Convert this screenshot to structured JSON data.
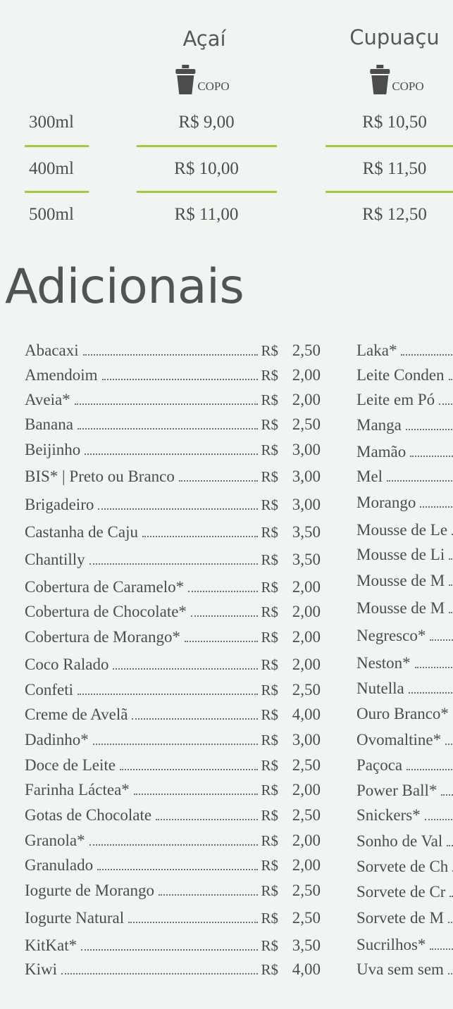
{
  "precos": {
    "colunas": [
      {
        "titulo": "Açaí",
        "copo": "COPO",
        "valores": [
          "R$ 9,00",
          "R$ 10,00",
          "R$ 11,00"
        ]
      },
      {
        "titulo": "Cupuaçu",
        "copo": "COPO",
        "valores": [
          "R$ 10,50",
          "R$ 11,50",
          "R$ 12,50"
        ]
      }
    ],
    "tamanhos": [
      "300ml",
      "400ml",
      "500ml"
    ],
    "accent": "#a6c93a"
  },
  "adicionais": {
    "titulo": "Adicionais",
    "moeda": "R$",
    "esquerda": [
      {
        "nome": "Abacaxi",
        "valor": "2,50"
      },
      {
        "nome": "Amendoim",
        "valor": "2,00"
      },
      {
        "nome": "Aveia*",
        "valor": "2,00"
      },
      {
        "nome": "Banana",
        "valor": "2,50"
      },
      {
        "nome": "Beijinho",
        "valor": "3,00"
      },
      {
        "nome": "BIS* | Preto ou Branco",
        "valor": "3,00"
      },
      {
        "nome": "Brigadeiro",
        "valor": "3,00"
      },
      {
        "nome": "Castanha de Caju",
        "valor": "3,50"
      },
      {
        "nome": "Chantilly",
        "valor": "3,50"
      },
      {
        "nome": "Cobertura de Caramelo*",
        "valor": "2,00"
      },
      {
        "nome": "Cobertura de Chocolate*",
        "valor": "2,00"
      },
      {
        "nome": "Cobertura de Morango*",
        "valor": "2,00"
      },
      {
        "nome": "Coco Ralado",
        "valor": "2,00"
      },
      {
        "nome": "Confeti",
        "valor": "2,50"
      },
      {
        "nome": "Creme de Avelã",
        "valor": "4,00"
      },
      {
        "nome": "Dadinho*",
        "valor": "3,00"
      },
      {
        "nome": "Doce de Leite",
        "valor": "2,50"
      },
      {
        "nome": "Farinha Láctea*",
        "valor": "2,00"
      },
      {
        "nome": "Gotas de Chocolate",
        "valor": "2,50"
      },
      {
        "nome": "Granola*",
        "valor": "2,00"
      },
      {
        "nome": "Granulado",
        "valor": "2,00"
      },
      {
        "nome": "Iogurte de Morango",
        "valor": "2,50"
      },
      {
        "nome": "Iogurte Natural",
        "valor": "2,50"
      },
      {
        "nome": "KitKat*",
        "valor": "3,50"
      },
      {
        "nome": "Kiwi",
        "valor": "4,00"
      }
    ],
    "direita": [
      {
        "nome": "Laka*"
      },
      {
        "nome": "Leite Conden"
      },
      {
        "nome": "Leite em Pó"
      },
      {
        "nome": "Manga"
      },
      {
        "nome": "Mamão"
      },
      {
        "nome": "Mel"
      },
      {
        "nome": "Morango"
      },
      {
        "nome": "Mousse de Le"
      },
      {
        "nome": "Mousse de Li"
      },
      {
        "nome": "Mousse de M"
      },
      {
        "nome": "Mousse de M"
      },
      {
        "nome": "Negresco*"
      },
      {
        "nome": "Neston*"
      },
      {
        "nome": "Nutella"
      },
      {
        "nome": "Ouro Branco*"
      },
      {
        "nome": "Ovomaltine*"
      },
      {
        "nome": "Paçoca"
      },
      {
        "nome": "Power Ball*"
      },
      {
        "nome": "Snickers*"
      },
      {
        "nome": "Sonho de Val"
      },
      {
        "nome": "Sorvete de Ch"
      },
      {
        "nome": "Sorvete de Cr"
      },
      {
        "nome": "Sorvete de M"
      },
      {
        "nome": "Sucrilhos*"
      },
      {
        "nome": "Uva sem sem"
      }
    ]
  }
}
